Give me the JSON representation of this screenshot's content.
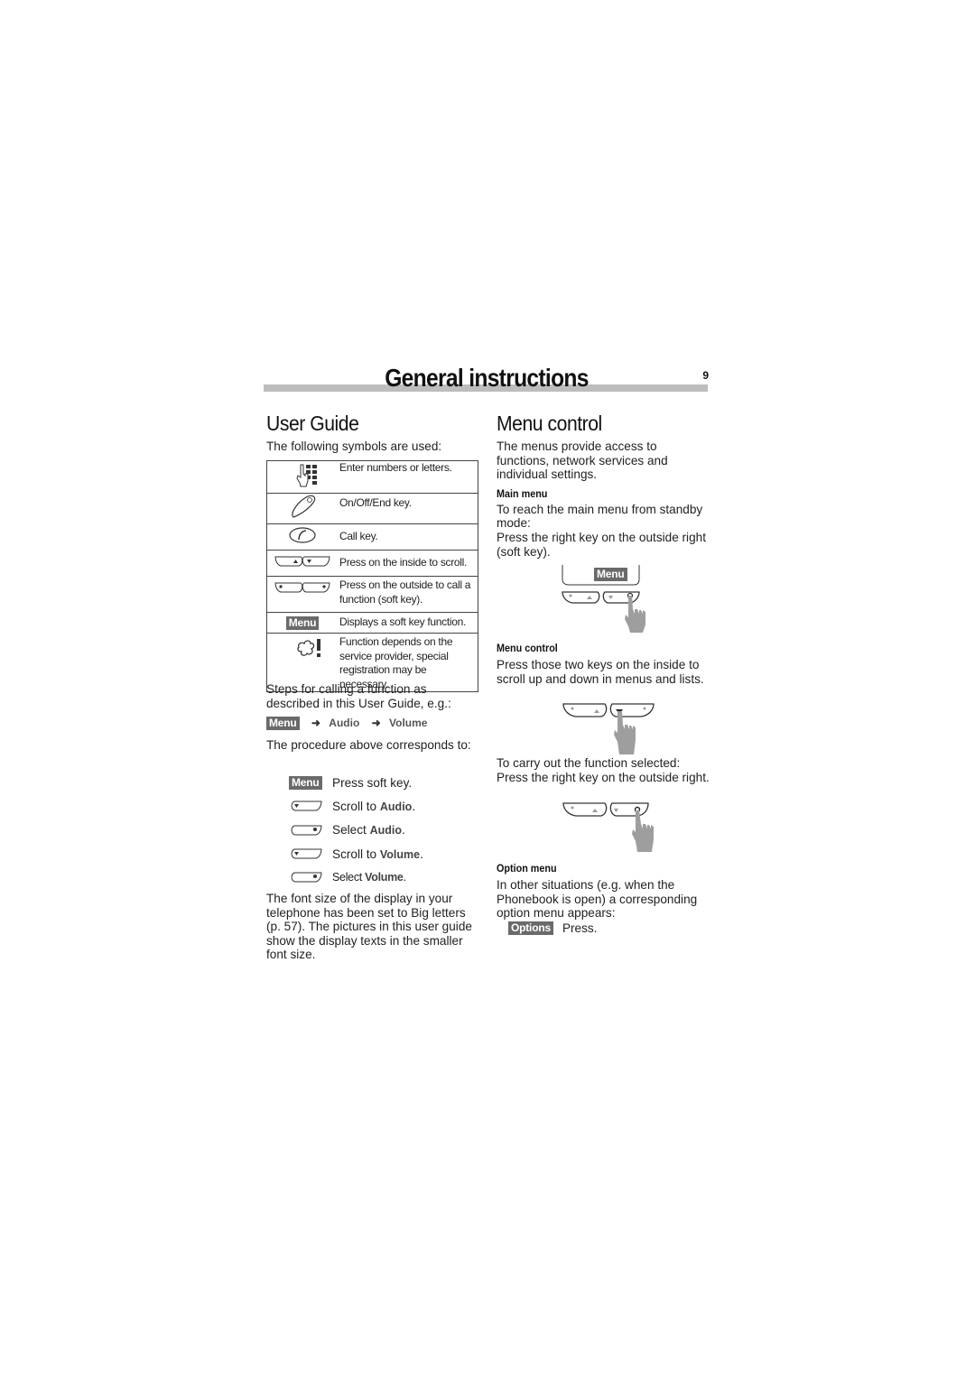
{
  "header": {
    "title": "General instructions",
    "page_number": "9"
  },
  "left": {
    "heading": "User Guide",
    "intro": "The following symbols are used:",
    "symbols": [
      {
        "icon": "keypad-hand-icon",
        "text": "Enter numbers or letters."
      },
      {
        "icon": "end-key-icon",
        "text": "On/Off/End key."
      },
      {
        "icon": "call-key-icon",
        "text": "Call key."
      },
      {
        "icon": "scroll-keys-inside-icon",
        "text": "Press on the inside to scroll."
      },
      {
        "icon": "soft-keys-outside-icon",
        "text": "Press on the outside to call a function (soft key)."
      },
      {
        "icon": "soft-key-badge",
        "badge": "Menu",
        "text": "Displays a soft key function."
      },
      {
        "icon": "provider-dependent-icon",
        "text": "Function depends on the service provider, special registration may be necessary."
      }
    ],
    "steps_intro": "Steps for calling a function as described in this User Guide, e.g.:",
    "path": {
      "start": "Menu",
      "items": [
        "Audio",
        "Volume"
      ]
    },
    "procedure_intro": "The procedure above corresponds to:",
    "steps": [
      {
        "icon": "menu-badge",
        "badge": "Menu",
        "text": "Press soft key.",
        "target": ""
      },
      {
        "icon": "scroll-down-key-icon",
        "text": "Scroll to ",
        "target": "Audio",
        "suffix": "."
      },
      {
        "icon": "select-key-icon",
        "text": "Select ",
        "target": "Audio",
        "suffix": "."
      },
      {
        "icon": "scroll-down-key-icon",
        "text": "Scroll to ",
        "target": "Volume",
        "suffix": "."
      },
      {
        "icon": "select-key-icon",
        "text": "Select ",
        "target": "Volume",
        "suffix": "."
      }
    ],
    "footer_note": "The font size of the display in your telephone has been set to Big letters (p. 57). The pictures in this user guide show the display texts in the smaller font size."
  },
  "right": {
    "heading": "Menu control",
    "intro": "The menus provide access to functions, network services and individual settings.",
    "main_menu": {
      "heading": "Main menu",
      "text1": "To reach the main menu from standby mode:",
      "text2": "Press the right key on the outside right (soft key).",
      "display_label": "Menu"
    },
    "menu_control": {
      "heading": "Menu control",
      "text": "Press those two keys on the inside to scroll up and down in menus and lists.",
      "text2": "To carry out the function selected: Press the right key on the outside right."
    },
    "option_menu": {
      "heading": "Option menu",
      "text": "In other situations (e.g. when the Phonebook is open) a corresponding option menu appears:",
      "badge": "Options",
      "action": "Press."
    }
  },
  "colors": {
    "header_bar": "#bdbdbd",
    "badge_bg": "#6a6a6a",
    "hand": "#9e9e9e"
  }
}
